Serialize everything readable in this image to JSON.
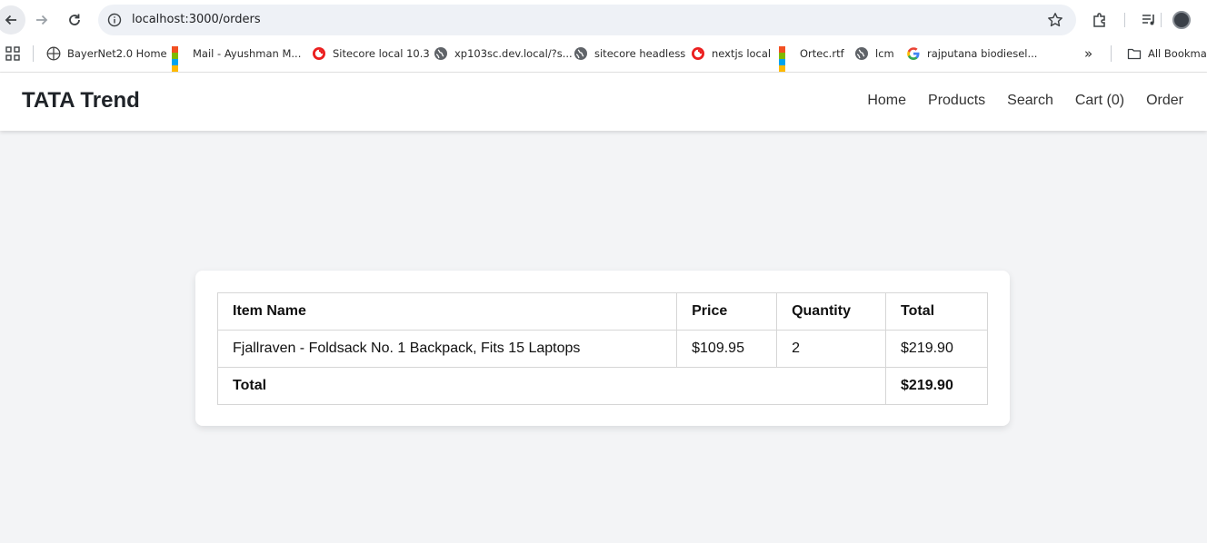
{
  "browser": {
    "url": "localhost:3000/orders",
    "bookmarks": [
      {
        "label": "BayerNet2.0 Home",
        "icon": "globe-cross-icon"
      },
      {
        "label": "Mail - Ayushman M...",
        "icon": "microsoft-icon"
      },
      {
        "label": "Sitecore local 10.3",
        "icon": "sitecore-icon"
      },
      {
        "label": "xp103sc.dev.local/?s...",
        "icon": "globe-icon"
      },
      {
        "label": "sitecore headless",
        "icon": "globe-icon"
      },
      {
        "label": "nextjs local",
        "icon": "sitecore-icon"
      },
      {
        "label": "Ortec.rtf",
        "icon": "microsoft-icon"
      },
      {
        "label": "lcm",
        "icon": "globe-icon"
      },
      {
        "label": "rajputana biodiesel...",
        "icon": "google-icon"
      }
    ],
    "more_label": "»",
    "all_bookmarks_label": "All Bookmarks"
  },
  "app": {
    "brand": "TATA Trend",
    "nav": [
      "Home",
      "Products",
      "Search",
      "Cart (0)",
      "Order"
    ]
  },
  "order": {
    "headers": [
      "Item Name",
      "Price",
      "Quantity",
      "Total"
    ],
    "items": [
      {
        "name": "Fjallraven - Foldsack No. 1 Backpack, Fits 15 Laptops",
        "price": "$109.95",
        "quantity": "2",
        "total": "$219.90"
      }
    ],
    "total_label": "Total",
    "grand_total": "$219.90"
  },
  "colors": {
    "page_bg": "#f3f4f6",
    "card_bg": "#ffffff",
    "border": "#d6d6d6",
    "text": "#111111"
  }
}
